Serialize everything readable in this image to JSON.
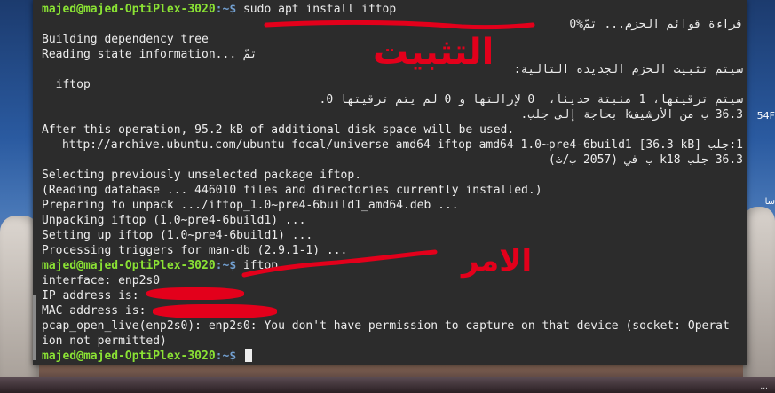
{
  "terminal": {
    "prompt_user": "majed@majed-OptiPlex-3020",
    "prompt_sep": ":~$",
    "lines": [
      {
        "kind": "prompt",
        "command": " sudo apt install iftop"
      },
      {
        "kind": "out",
        "text": "قراءة قوائم الحزم... تمّ%0"
      },
      {
        "kind": "out",
        "text": "Building dependency tree"
      },
      {
        "kind": "out",
        "text": "Reading state information... تمّ"
      },
      {
        "kind": "out",
        "text": "سيتم تثبيت الحزم الجديدة التالية:"
      },
      {
        "kind": "out",
        "text": "  iftop"
      },
      {
        "kind": "out",
        "text": "سيتم ترقيتها، 1 مثبتة حديثاً،  0 لإزالتها و 0 لم يتم ترقيتها 0."
      },
      {
        "kind": "out",
        "text": "36.3 ب من الأرشيفk بحاجة إلى جلب."
      },
      {
        "kind": "out",
        "text": "After this operation, 95.2 kB of additional disk space will be used."
      },
      {
        "kind": "out",
        "text": "1:جلب http://archive.ubuntu.com/ubuntu focal/universe amd64 iftop amd64 1.0~pre4-6build1 [36.3 kB]"
      },
      {
        "kind": "out",
        "text": "36.3 جلب k18 ب في (2057 ب/ث)"
      },
      {
        "kind": "out",
        "text": "Selecting previously unselected package iftop."
      },
      {
        "kind": "out",
        "text": "(Reading database ... 446010 files and directories currently installed.)"
      },
      {
        "kind": "out",
        "text": "Preparing to unpack .../iftop_1.0~pre4-6build1_amd64.deb ..."
      },
      {
        "kind": "out",
        "text": "Unpacking iftop (1.0~pre4-6build1) ..."
      },
      {
        "kind": "out",
        "text": "Setting up iftop (1.0~pre4-6build1) ..."
      },
      {
        "kind": "out",
        "text": "Processing triggers for man-db (2.9.1-1) ..."
      },
      {
        "kind": "prompt",
        "command": " iftop"
      },
      {
        "kind": "out",
        "text": "interface: enp2s0"
      },
      {
        "kind": "out",
        "text": "IP address is:"
      },
      {
        "kind": "out",
        "text": "MAC address is:"
      },
      {
        "kind": "out",
        "text": "pcap_open_live(enp2s0): enp2s0: You don't have permission to capture on that device (socket: Operat"
      },
      {
        "kind": "out",
        "text": "ion not permitted)"
      },
      {
        "kind": "prompt-cursor",
        "command": " "
      }
    ]
  },
  "annotations": {
    "install_label": "التثبيت",
    "then_label": "الامر",
    "color": "#e3001b"
  },
  "desktop": {
    "right_label_1": "54F",
    "right_label_2": "سا",
    "bottom_label": "..."
  },
  "colors": {
    "terminal_bg": "#2c2c2c",
    "text": "#ededed",
    "prompt_user": "#8ae234",
    "prompt_path": "#729fcf"
  }
}
